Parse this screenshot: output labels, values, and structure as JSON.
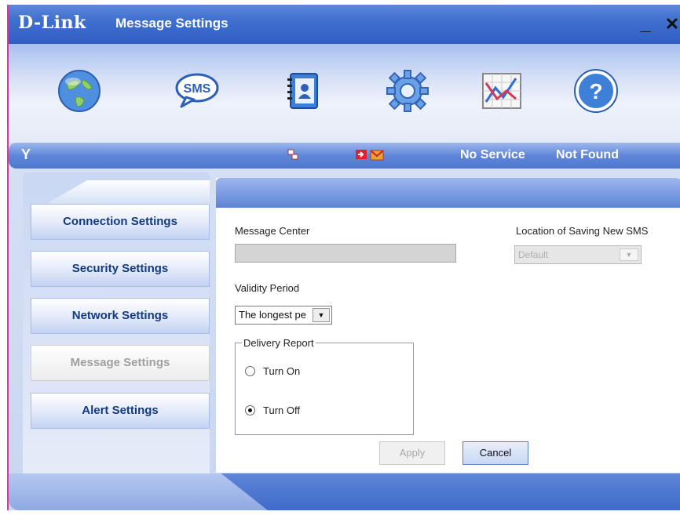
{
  "app": {
    "logo": "D-Link",
    "title": "Message Settings",
    "minimize_label": "_",
    "close_label": "✕"
  },
  "toolbar": {
    "items": [
      {
        "name": "internet",
        "icon": "globe-icon"
      },
      {
        "name": "sms",
        "icon": "sms-bubble-icon",
        "label": "SMS"
      },
      {
        "name": "phonebook",
        "icon": "contacts-book-icon"
      },
      {
        "name": "settings",
        "icon": "gear-icon"
      },
      {
        "name": "statistics",
        "icon": "chart-icon"
      },
      {
        "name": "help",
        "icon": "help-icon",
        "label": "?"
      }
    ]
  },
  "status": {
    "signal_icon": "antenna-icon",
    "network_icon": "network-icon",
    "messages_icons": [
      "sms-inbox-icon",
      "envelope-icon"
    ],
    "service": "No Service",
    "device": "Not Found"
  },
  "nav": {
    "items": [
      {
        "label": "Connection Settings",
        "enabled": true
      },
      {
        "label": "Security Settings",
        "enabled": true
      },
      {
        "label": "Network Settings",
        "enabled": true
      },
      {
        "label": "Message Settings",
        "enabled": false
      },
      {
        "label": "Alert Settings",
        "enabled": true
      }
    ]
  },
  "form": {
    "message_center_label": "Message Center",
    "message_center_value": "",
    "location_label": "Location of Saving New SMS",
    "location_value": "Default",
    "validity_label": "Validity Period",
    "validity_value": "The longest pe",
    "delivery_label": "Delivery Report",
    "turn_on_label": "Turn On",
    "turn_off_label": "Turn Off",
    "delivery_selected": "Turn Off",
    "apply_label": "Apply",
    "cancel_label": "Cancel"
  }
}
